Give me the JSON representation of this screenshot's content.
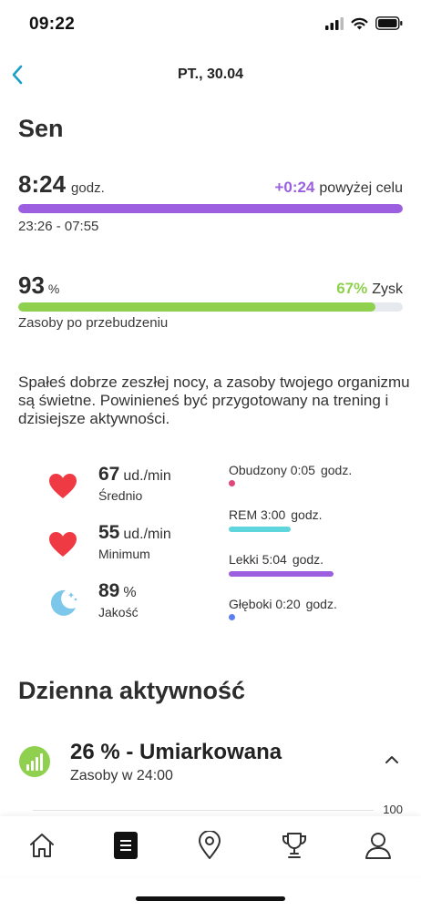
{
  "status_bar": {
    "time": "09:22"
  },
  "header": {
    "title": "PT., 30.04"
  },
  "sleep": {
    "title": "Sen",
    "duration": "8:24",
    "duration_unit": "godz.",
    "goal_diff": "+0:24",
    "goal_label": "powyżej celu",
    "duration_progress": 1.0,
    "time_range": "23:26 - 07:55",
    "resources_value": "93",
    "resources_unit": "%",
    "gain_value": "67%",
    "gain_label": "Zysk",
    "resources_progress": 0.93,
    "resources_label": "Zasoby po przebudzeniu",
    "description": "Spałeś dobrze zeszłej nocy, a zasoby twojego organizmu są świetne. Powinieneś być przygotowany na trening i dzisiejsze aktywności.",
    "stats": [
      {
        "value": "67",
        "unit": "ud./min",
        "label": "Średnio",
        "icon": "heart-icon"
      },
      {
        "value": "55",
        "unit": "ud./min",
        "label": "Minimum",
        "icon": "heart-icon"
      },
      {
        "value": "89",
        "unit": "%",
        "label": "Jakość",
        "icon": "moon-icon"
      }
    ],
    "phases": [
      {
        "name": "Obudzony",
        "duration": "0:05",
        "unit": "godz.",
        "color": "#e0457b"
      },
      {
        "name": "REM",
        "duration": "3:00",
        "unit": "godz.",
        "color": "#5fd6dd"
      },
      {
        "name": "Lekki",
        "duration": "5:04",
        "unit": "godz.",
        "color": "#9b5fe0"
      },
      {
        "name": "Głęboki",
        "duration": "0:20",
        "unit": "godz.",
        "color": "#5b7ff0"
      }
    ]
  },
  "activity": {
    "title": "Dzienna aktywność",
    "level": "26 % - Umiarkowana",
    "sub": "Zasoby w 24:00",
    "chart_max": "100"
  },
  "colors": {
    "accent": "#1aa0c8",
    "purple": "#9b5fe0",
    "green": "#8fd14f",
    "heart": "#ef3a44"
  },
  "tabs": [
    {
      "name": "home-icon"
    },
    {
      "name": "diary-icon"
    },
    {
      "name": "map-pin-icon"
    },
    {
      "name": "trophy-icon"
    },
    {
      "name": "profile-icon"
    }
  ]
}
